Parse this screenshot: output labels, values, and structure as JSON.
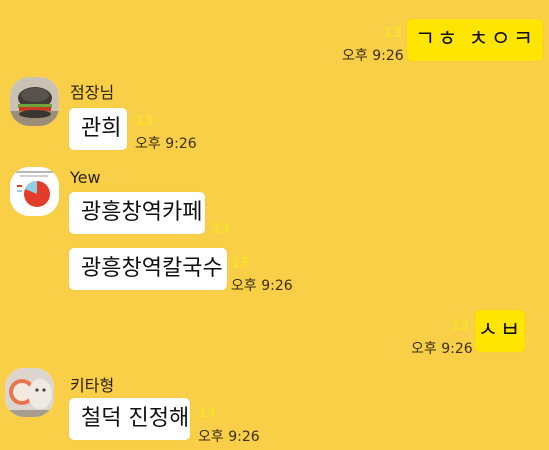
{
  "messages": {
    "m1": {
      "text": "ㄱㅎ ㅊㅇㅋ",
      "unread": "13",
      "time": "오후 9:26"
    },
    "m2": {
      "sender": "점장님",
      "text": "관희",
      "unread": "13",
      "time": "오후 9:26"
    },
    "m3": {
      "sender": "Yew",
      "text": "광흥창역카페",
      "unread": "13"
    },
    "m4": {
      "text": "광흥창역칼국수",
      "unread": "13",
      "time": "오후 9:26"
    },
    "m5": {
      "text": "ㅅㅂ",
      "unread": "13",
      "time": "오후 9:26"
    },
    "m6": {
      "sender": "키타형",
      "text": "철덕 진정해",
      "unread": "13",
      "time": "오후 9:26"
    }
  },
  "colors": {
    "background": "#F9CF47",
    "my_bubble": "#FFE500",
    "other_bubble": "#FFFFFF",
    "unread": "#F6E12B"
  }
}
